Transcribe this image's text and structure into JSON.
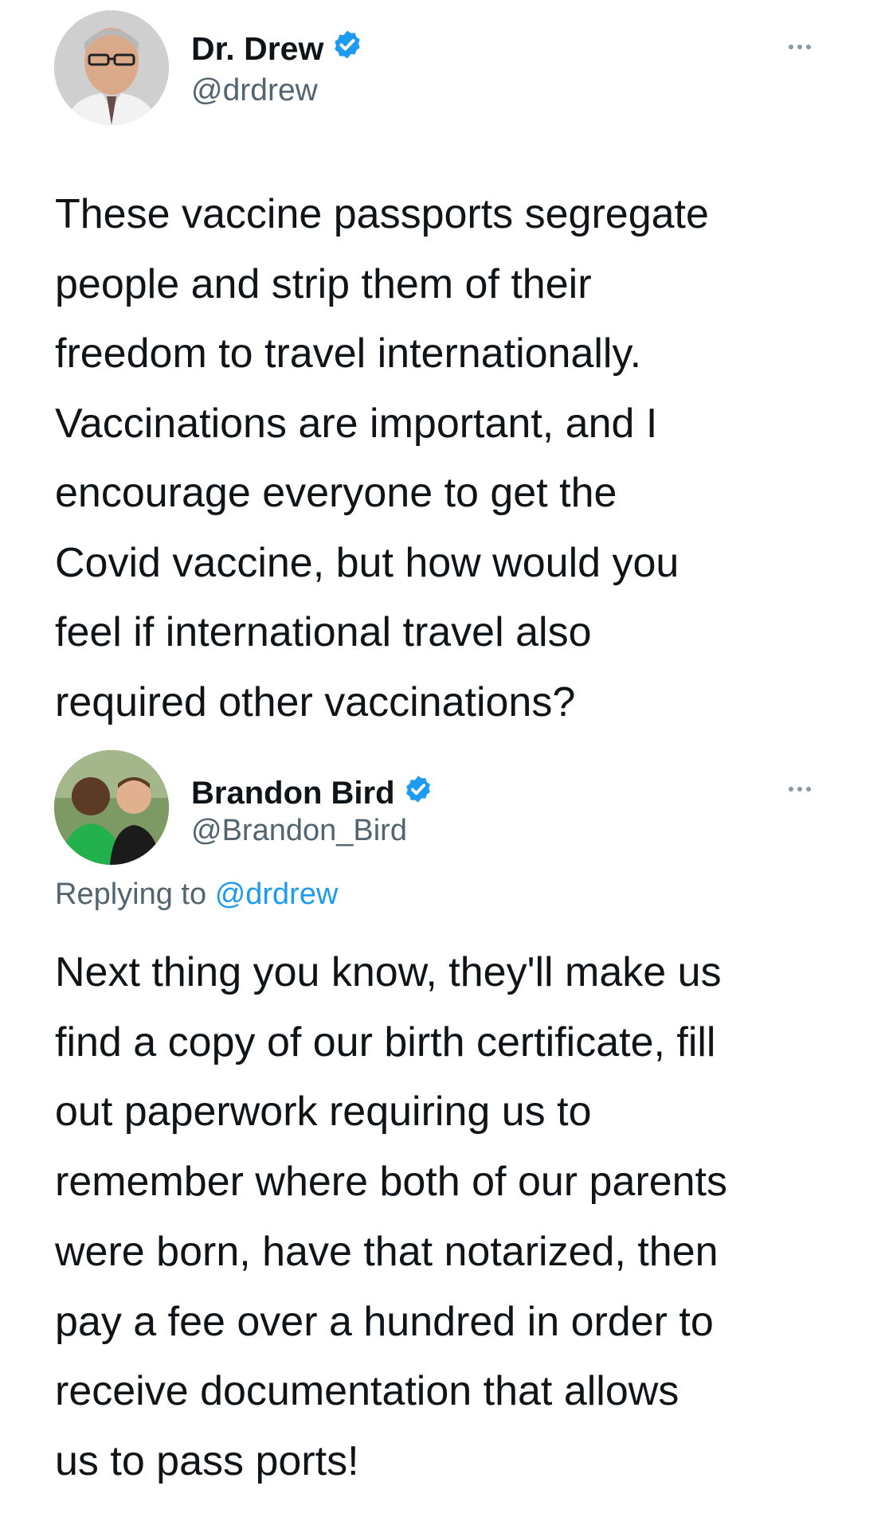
{
  "tweet1": {
    "name": "Dr. Drew",
    "handle": "@drdrew",
    "avatar": "dr-drew-portrait",
    "lines": [
      "These vaccine passports segregate",
      "people and strip them of their",
      "freedom to travel internationally.",
      "Vaccinations are important, and I",
      "encourage everyone to get the",
      "Covid vaccine, but how would you",
      "feel if international travel also",
      "required other vaccinations?"
    ]
  },
  "tweet2": {
    "name": "Brandon Bird",
    "handle": "@Brandon_Bird",
    "avatar": "two-men-photo",
    "replying_prefix": "Replying to",
    "replying_mention": "@drdrew",
    "lines": [
      "Next thing you know, they'll make us",
      "find a copy of our birth certificate, fill",
      "out paperwork requiring us to",
      "remember where both of our parents",
      "were born, have that notarized, then",
      "pay a fee over a hundred in order to",
      "receive documentation that allows",
      "us to pass ports!"
    ]
  },
  "icons": {
    "verified": "verified-badge-icon",
    "more": "more-options-icon"
  },
  "colors": {
    "text": "#0f1419",
    "secondary": "#536471",
    "accent": "#1d9bf0"
  }
}
